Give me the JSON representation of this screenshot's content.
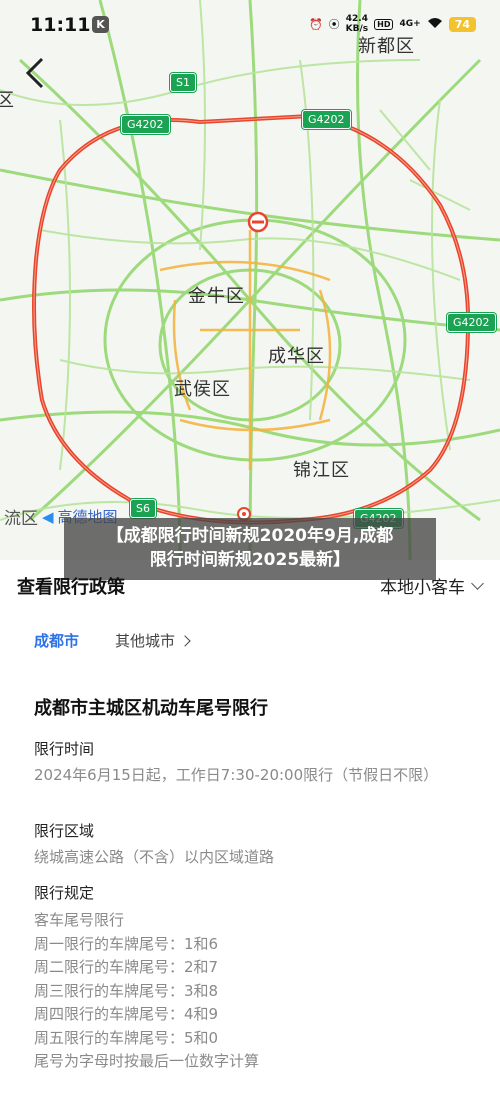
{
  "status_bar": {
    "time": "11:11",
    "app_badge": "K",
    "speed_value": "42.4",
    "speed_unit": "KB/s",
    "hd_label": "HD",
    "network": "4G+",
    "battery": "74"
  },
  "map": {
    "districts": [
      "新都区",
      "金牛区",
      "成华区",
      "武侯区",
      "锦江区"
    ],
    "partial_labels": {
      "left_top": "区",
      "left_bottom": "流区"
    },
    "highway_shields": [
      "S1",
      "G4202",
      "G4202",
      "G4202",
      "S6",
      "G4202"
    ],
    "logo_text": "高德地图",
    "colors": {
      "ring_road": "#e8452c",
      "arterial": "#8fd66a",
      "background": "#f4f6f2"
    }
  },
  "overlay_title": {
    "line1": "【成都限行时间新规2020年9月,成都",
    "line2": "限行时间新规2025最新】"
  },
  "policy_panel": {
    "title": "查看限行政策",
    "vehicle_type": "本地小客车",
    "tabs": [
      {
        "label": "成都市",
        "active": true
      },
      {
        "label": "其他城市",
        "active": false
      }
    ],
    "rule_title": "成都市主城区机动车尾号限行",
    "sections": {
      "time_label": "限行时间",
      "time_text": "2024年6月15日起，工作日7:30-20:00限行（节假日不限）",
      "area_label": "限行区域",
      "area_text": "绕城高速公路（不含）以内区域道路",
      "rules_label": "限行规定",
      "rules_lines": [
        "客车尾号限行",
        "周一限行的车牌尾号：1和6",
        "周二限行的车牌尾号：2和7",
        "周三限行的车牌尾号：3和8",
        "周四限行的车牌尾号：4和9",
        "周五限行的车牌尾号：5和0",
        "尾号为字母时按最后一位数字计算"
      ]
    },
    "colors": {
      "accent": "#2d72e8"
    }
  }
}
